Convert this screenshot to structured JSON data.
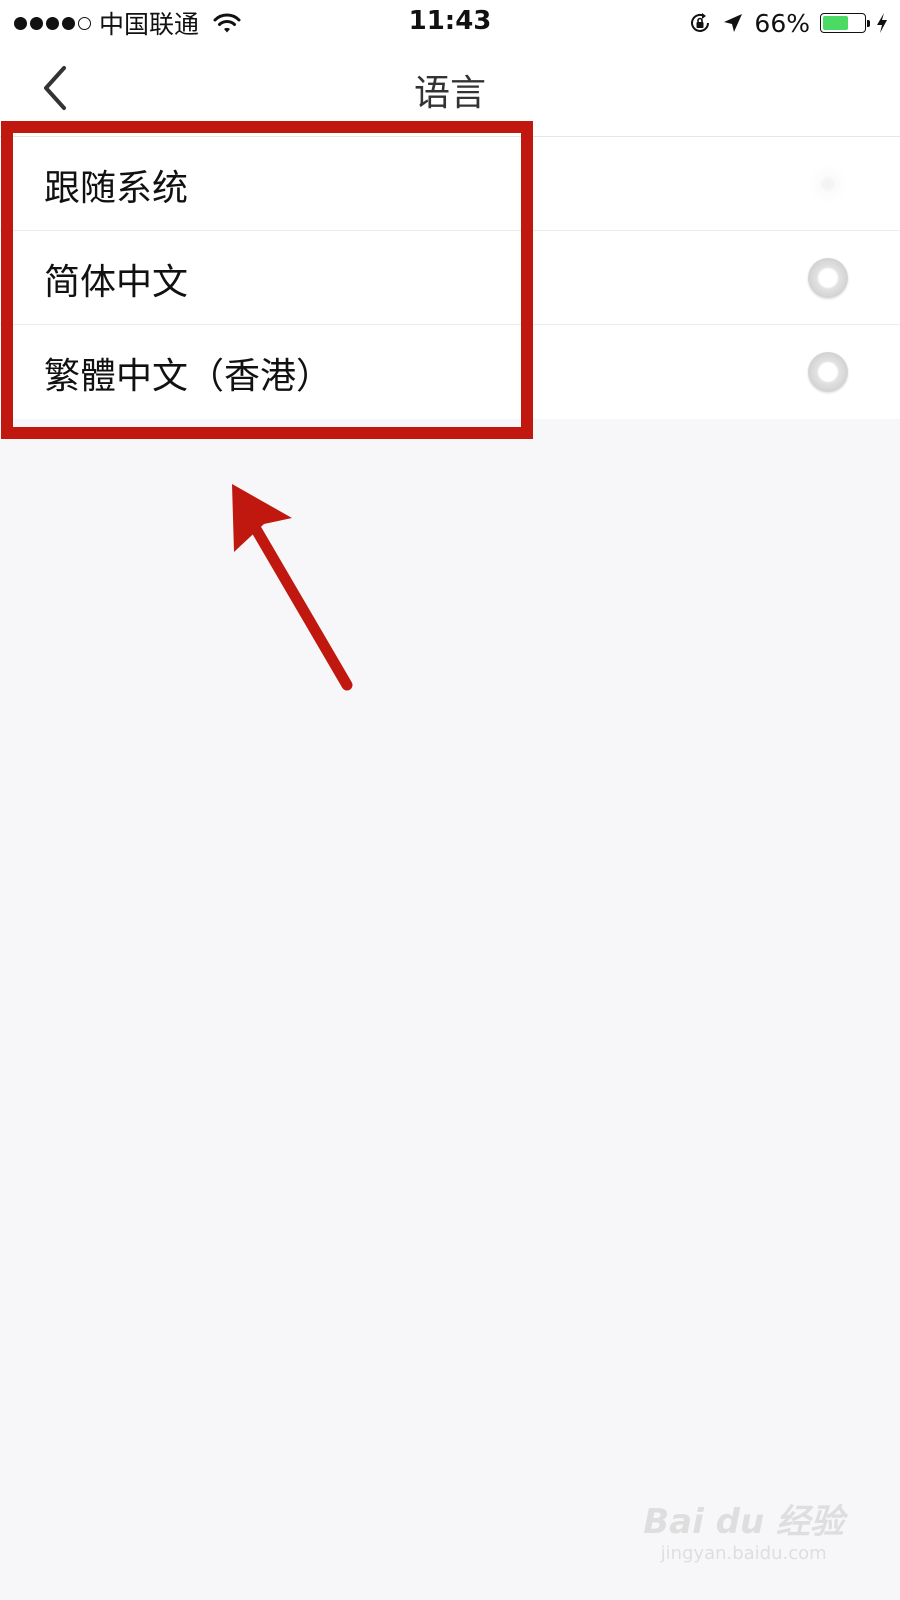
{
  "status_bar": {
    "carrier": "中国联通",
    "time": "11:43",
    "battery_percent": "66%",
    "battery_level": 0.66,
    "icons": [
      "signal-dots-icon",
      "wifi-icon",
      "orientation-lock-icon",
      "location-arrow-icon",
      "battery-icon",
      "charging-bolt-icon"
    ]
  },
  "nav": {
    "title": "语言",
    "back_icon": "chevron-left-icon"
  },
  "language_options": [
    {
      "label": "跟随系统"
    },
    {
      "label": "简体中文"
    },
    {
      "label": "繁體中文（香港）"
    }
  ],
  "annotation": {
    "highlight_color": "#c0170f"
  },
  "watermark": {
    "main": "Bai du 经验",
    "sub": "jingyan.baidu.com"
  }
}
